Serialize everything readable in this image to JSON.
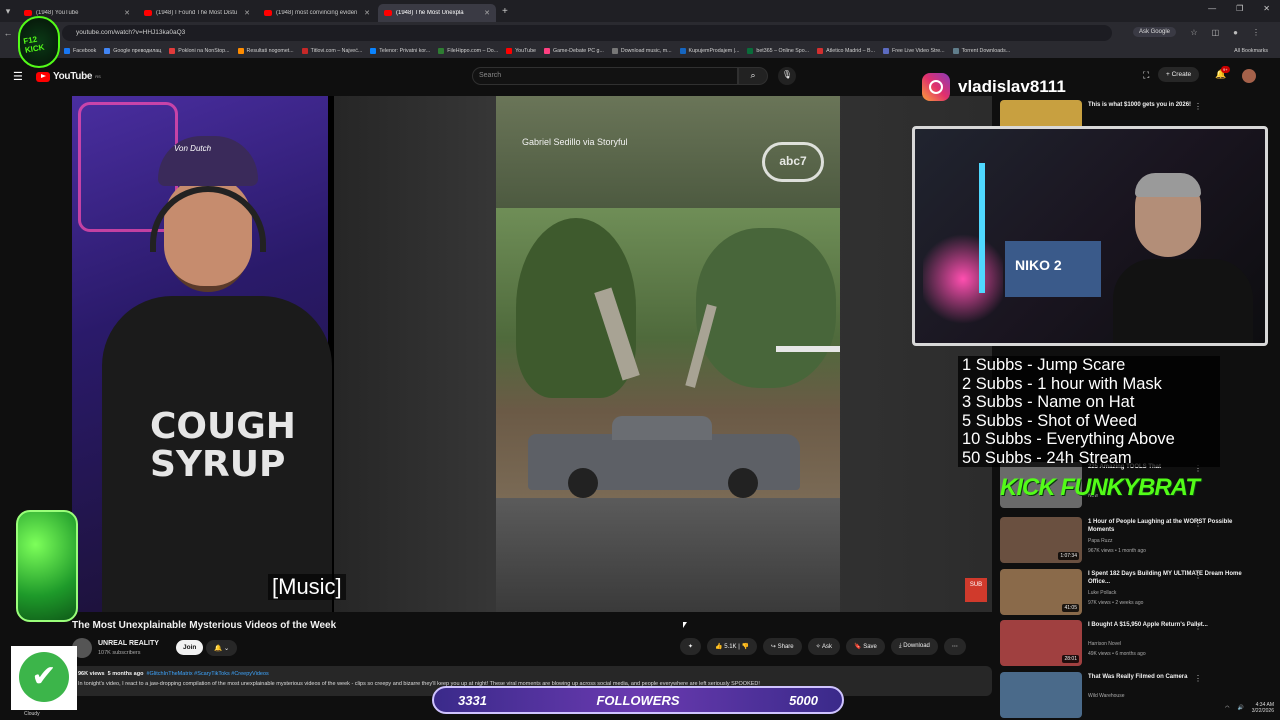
{
  "browser": {
    "tabs": [
      {
        "title": "(1948) YouTube",
        "active": false
      },
      {
        "title": "(1948) I Found The Most Distu",
        "active": false
      },
      {
        "title": "(1948) most convincing eviden",
        "active": false
      },
      {
        "title": "(1948) The Most Unexpla",
        "active": true
      }
    ],
    "url": "youtube.com/watch?v=HHJ13ka0aQ3",
    "ask_google": "Ask Google",
    "bookmarks": [
      {
        "label": "Facebook",
        "color": "#1877f2"
      },
      {
        "label": "Google преводилац",
        "color": "#4285f4"
      },
      {
        "label": "Pokloni na NonStop...",
        "color": "#e23b3b"
      },
      {
        "label": "Resultati nogomet...",
        "color": "#ff8c00"
      },
      {
        "label": "Titlovi.com – Najveć...",
        "color": "#c62828"
      },
      {
        "label": "Telenor: Privatni kor...",
        "color": "#0a84ff"
      },
      {
        "label": "FileHippo.com – Do...",
        "color": "#2e7d32"
      },
      {
        "label": "YouTube",
        "color": "#ff0000"
      },
      {
        "label": "Game-Debate PC g...",
        "color": "#ff4081"
      },
      {
        "label": "Download music, m...",
        "color": "#777"
      },
      {
        "label": "KupujemProdajem |...",
        "color": "#1565c0"
      },
      {
        "label": "bet365 – Online Spo...",
        "color": "#0a6c3a"
      },
      {
        "label": "Atletico Madrid – B...",
        "color": "#d32f2f"
      },
      {
        "label": "Free Live Video Stre...",
        "color": "#5c6bc0"
      },
      {
        "label": "Torrent Downloads...",
        "color": "#607d8b"
      }
    ],
    "all_bookmarks": "All Bookmarks"
  },
  "youtube": {
    "logo_text": "YouTube",
    "region": "RS",
    "search_placeholder": "Search",
    "create_label": "Create",
    "notification_count": "9+"
  },
  "video": {
    "credit": "Gabriel Sedillo via Storyful",
    "network_logo": "abc7",
    "shirt_text": "COUGH SYRUP",
    "cap_text": "Von Dutch",
    "caption": "[Music]",
    "subs_logo": "SUB",
    "title": "The Most Unexplainable Mysterious Videos of the Week",
    "channel": "UNREAL REALITY",
    "subscribers": "107K subscribers",
    "join_label": "Join",
    "likes": "5.1K",
    "share_label": "Share",
    "ask_label": "Ask",
    "save_label": "Save",
    "download_label": "Download",
    "views": "96K views",
    "age": "5 months ago",
    "tags": "#GlitchInTheMatrix #ScaryTikToks #CreepyVideos",
    "description": "In tonight's video, I react to a jaw-dropping compilation of the most unexplainable mysterious videos of the week - clips so creepy and bizarre they'll keep you up at night! These viral moments are blowing up across social media, and people everywhere are left seriously SPOOKED!"
  },
  "overlay": {
    "kick_badge": "F12 KICK",
    "instagram_handle": "vladislav8111",
    "sub_goals": [
      "1 Subbs - Jump Scare",
      "2 Subbs - 1 hour with Mask",
      "3 Subbs - Name on Hat",
      "5 Subbs - Shot of Weed",
      "10 Subbs - Everything Above",
      "50 Subbs - 24h Stream"
    ],
    "kick_brand": "KICK FUNKYBRAT",
    "cam_screen_text": "NIKO 2",
    "followers_current": "3331",
    "followers_label": "FOLLOWERS",
    "followers_goal": "5000",
    "weather": "Cloudy"
  },
  "recommendations": [
    {
      "title": "This is what $1000 gets you in 2026!",
      "channel": "",
      "meta": "",
      "duration": "",
      "thumb": "#c8a040"
    },
    {
      "title": "225 Amazing TOOLS That",
      "channel": "",
      "meta": "New",
      "duration": "",
      "thumb": "#6a6a6a"
    },
    {
      "title": "1 Hour of People Laughing at the WORST Possible Moments",
      "channel": "Papa Ruzz",
      "meta": "967K views • 1 month ago",
      "duration": "1:07:34",
      "thumb": "#6a5040"
    },
    {
      "title": "I Spent 182 Days Building MY ULTIMATE Dream Home Office...",
      "channel": "Luke Pollack",
      "meta": "97K views • 2 weeks ago",
      "duration": "41:05",
      "thumb": "#8a6a4a"
    },
    {
      "title": "I Bought A $15,950 Apple Return's Pallet...",
      "channel": "Harrison Novel",
      "meta": "49K views • 6 months ago",
      "duration": "28:01",
      "thumb": "#a04040"
    },
    {
      "title": "That Was Really Filmed on Camera",
      "channel": "Wild Warehouse",
      "meta": "",
      "duration": "",
      "thumb": "#4a6a8a"
    }
  ],
  "taskbar": {
    "time": "4:34 AM",
    "date": "3/22/2026"
  },
  "colors": {
    "kick_green": "#53fc18",
    "yt_red": "#ff0000",
    "followers_purple": "#6a3ab0"
  }
}
